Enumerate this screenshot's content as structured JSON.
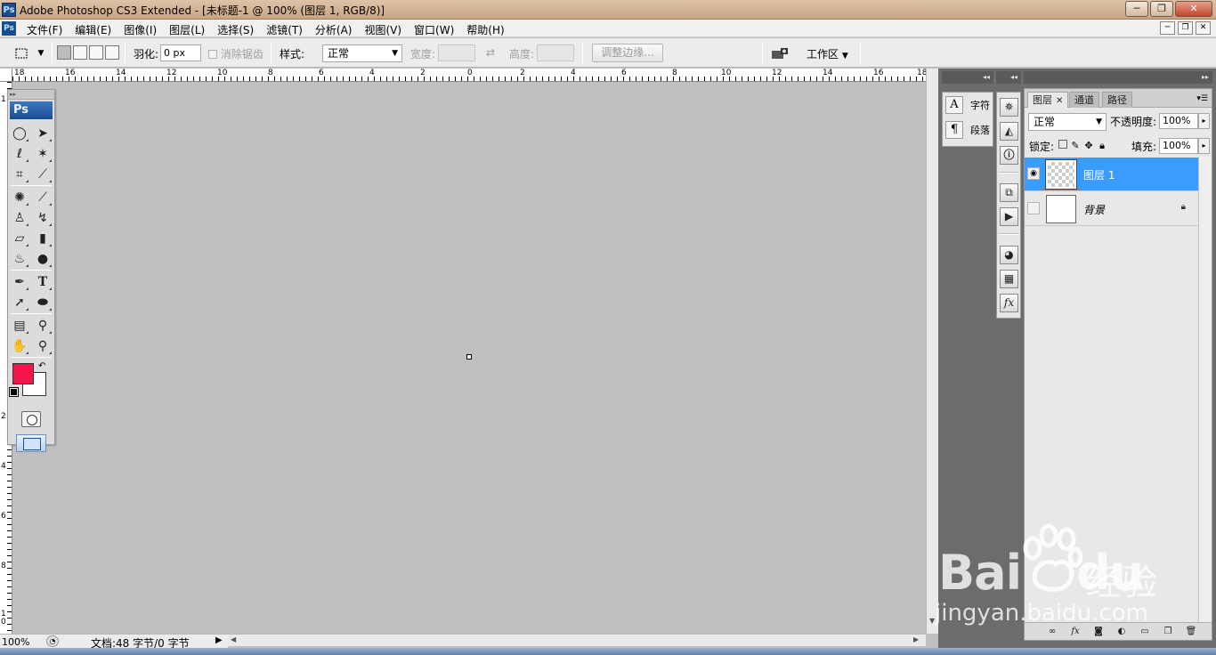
{
  "window": {
    "title": "Adobe Photoshop CS3 Extended - [未标题-1 @ 100% (图层 1, RGB/8)]",
    "app_icon": "Ps",
    "minimize": "─",
    "restore": "❐",
    "close": "✕"
  },
  "menu": {
    "icon": "Ps",
    "items": [
      "文件(F)",
      "编辑(E)",
      "图像(I)",
      "图层(L)",
      "选择(S)",
      "滤镜(T)",
      "分析(A)",
      "视图(V)",
      "窗口(W)",
      "帮助(H)"
    ],
    "doc_minimize": "─",
    "doc_restore": "❐",
    "doc_close": "✕"
  },
  "options": {
    "tool_icon": "marquee-icon",
    "feather_label": "羽化:",
    "feather_value": "0 px",
    "antialias_label": "消除锯齿",
    "style_label": "样式:",
    "style_value": "正常",
    "width_label": "宽度:",
    "height_label": "高度:",
    "refine_edge": "调整边缘...",
    "workspace": "工作区"
  },
  "rulers": {
    "top_labels": [
      "18",
      "16",
      "14",
      "12",
      "10",
      "8",
      "6",
      "4",
      "2",
      "0",
      "2",
      "4",
      "6",
      "8",
      "10",
      "12",
      "14",
      "16",
      "18"
    ],
    "left_labels": [
      "1",
      "2",
      "4",
      "6",
      "8",
      "1\n0"
    ]
  },
  "status": {
    "zoom": "100%",
    "doc_info": "文档:48 字节/0 字节",
    "arrow": "▶"
  },
  "toolbox": {
    "logo": "Ps",
    "colors": {
      "foreground": "#f5154a",
      "background": "#ffffff"
    }
  },
  "mini_panel": {
    "character_label": "字符",
    "paragraph_label": "段落"
  },
  "layers_panel": {
    "tabs": [
      "图层",
      "通道",
      "路径"
    ],
    "blend_mode": "正常",
    "opacity_label": "不透明度:",
    "opacity_value": "100%",
    "lock_label": "锁定:",
    "fill_label": "填充:",
    "fill_value": "100%",
    "layers": [
      {
        "name": "图层 1",
        "visible": true,
        "selected": true,
        "locked": false
      },
      {
        "name": "背景",
        "visible": false,
        "selected": false,
        "locked": true
      }
    ]
  },
  "watermark": {
    "brand": "Bai",
    "brand_tail": "du",
    "cn": "经验",
    "url": "jingyan.baidu.com"
  }
}
